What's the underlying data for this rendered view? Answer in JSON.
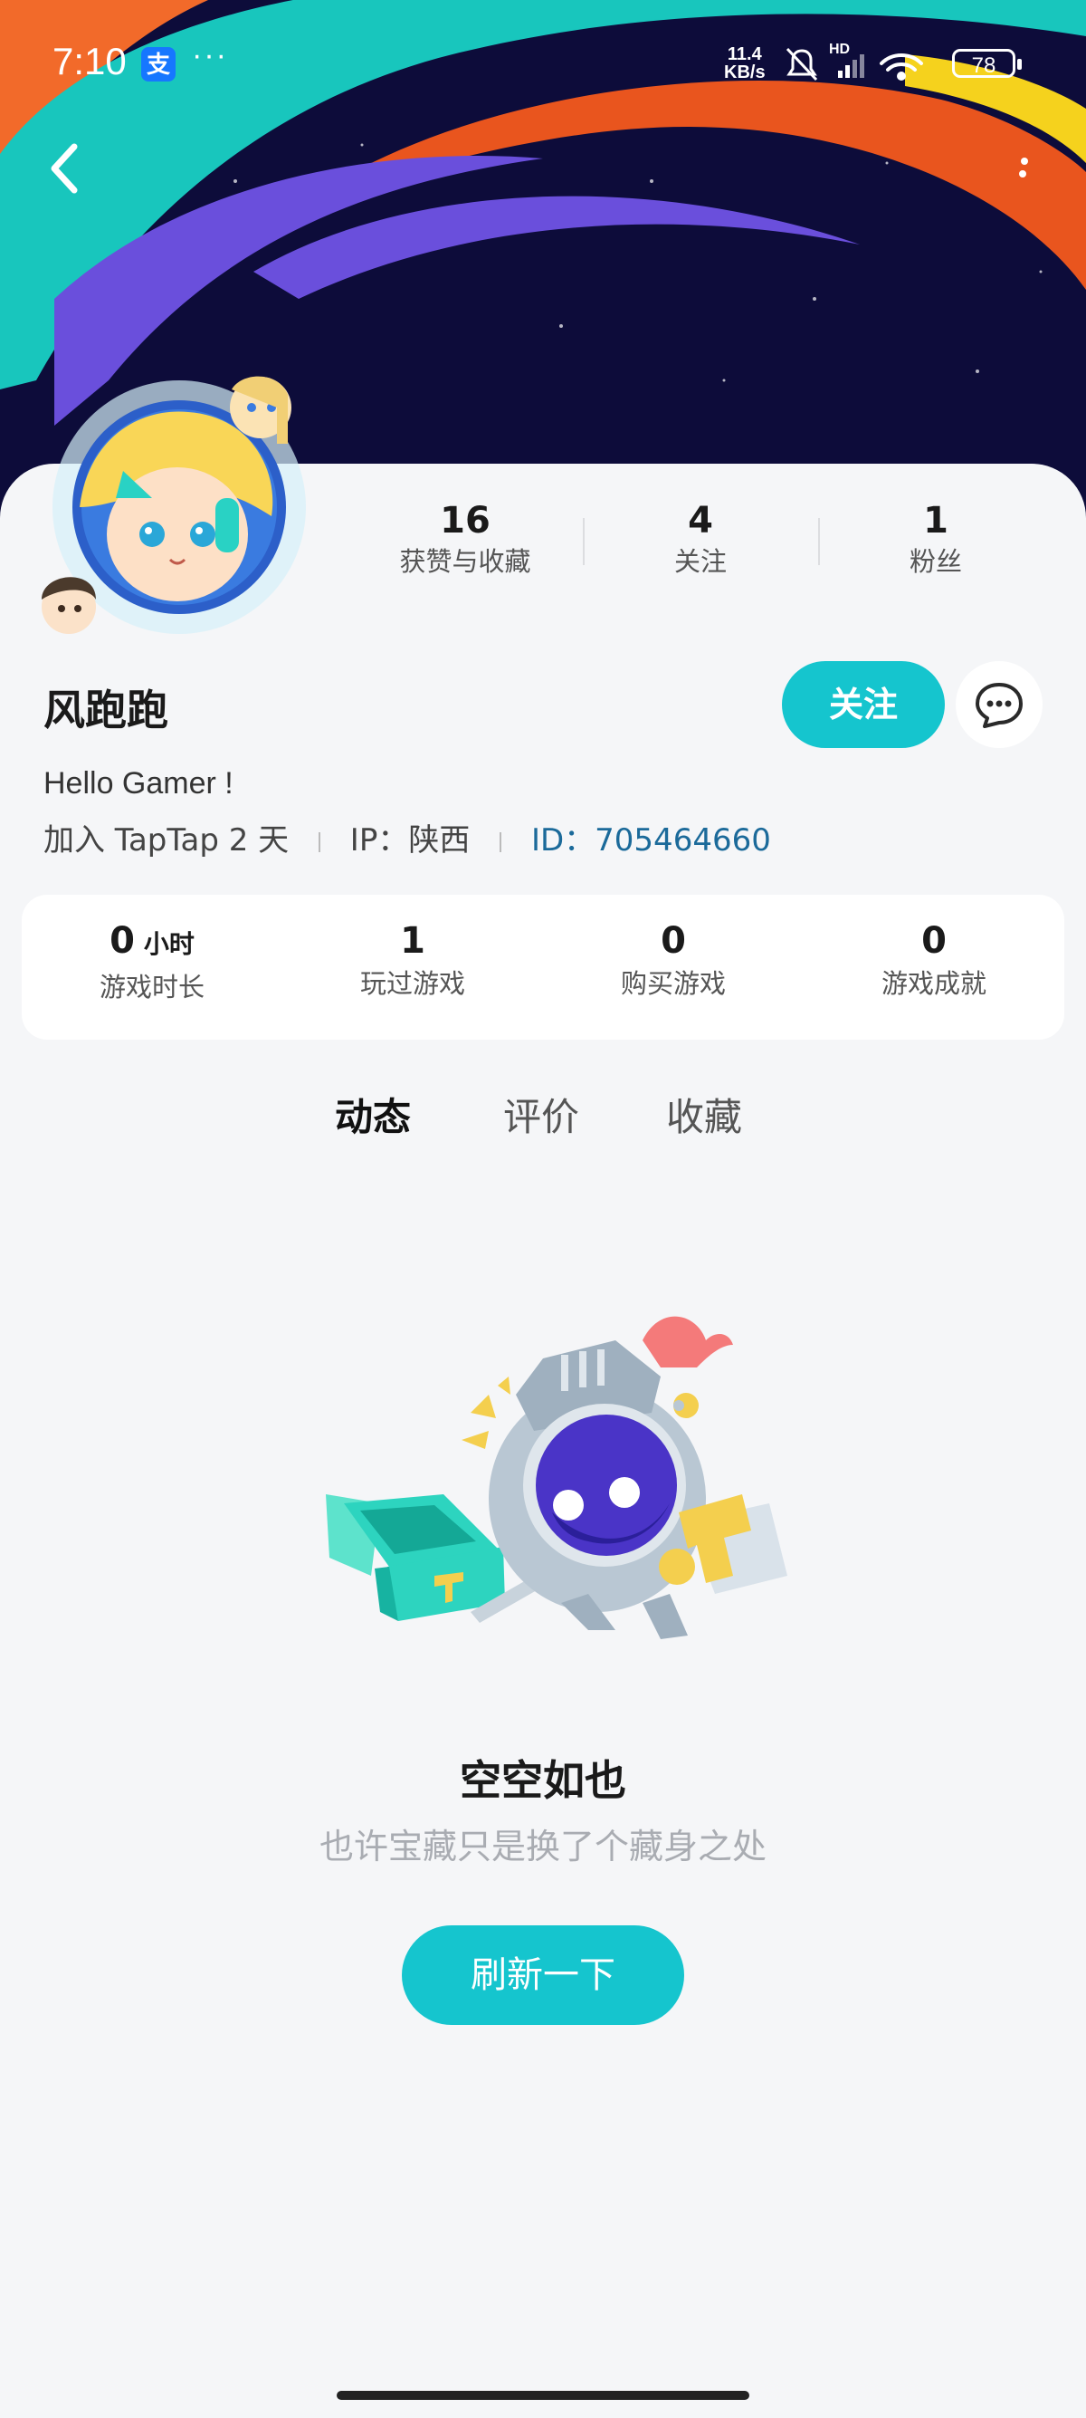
{
  "status_bar": {
    "time": "7:10",
    "alipay_icon_text": "支",
    "more_dots": "···",
    "net_speed_value": "11.4",
    "net_speed_unit": "KB/s",
    "signal_label": "HD",
    "battery": "78"
  },
  "profile": {
    "username": "风跑跑",
    "bio": "Hello Gamer !",
    "join_text": "加入 TapTap 2 天",
    "ip_text": "IP：陕西",
    "id_text": "ID：705464660",
    "follow_label": "关注"
  },
  "social_stats": [
    {
      "value": "16",
      "label": "获赞与收藏"
    },
    {
      "value": "4",
      "label": "关注"
    },
    {
      "value": "1",
      "label": "粉丝"
    }
  ],
  "game_stats": [
    {
      "value": "0",
      "unit": "小时",
      "label": "游戏时长"
    },
    {
      "value": "1",
      "unit": "",
      "label": "玩过游戏"
    },
    {
      "value": "0",
      "unit": "",
      "label": "购买游戏"
    },
    {
      "value": "0",
      "unit": "",
      "label": "游戏成就"
    }
  ],
  "tabs": [
    {
      "label": "动态",
      "active": true
    },
    {
      "label": "评价",
      "active": false
    },
    {
      "label": "收藏",
      "active": false
    }
  ],
  "empty_state": {
    "title": "空空如也",
    "subtitle": "也许宝藏只是换了个藏身之处",
    "refresh_label": "刷新一下"
  },
  "colors": {
    "accent": "#15c5ce",
    "banner_bg": "#0d0c3a",
    "id_link": "#1b6a9a"
  }
}
